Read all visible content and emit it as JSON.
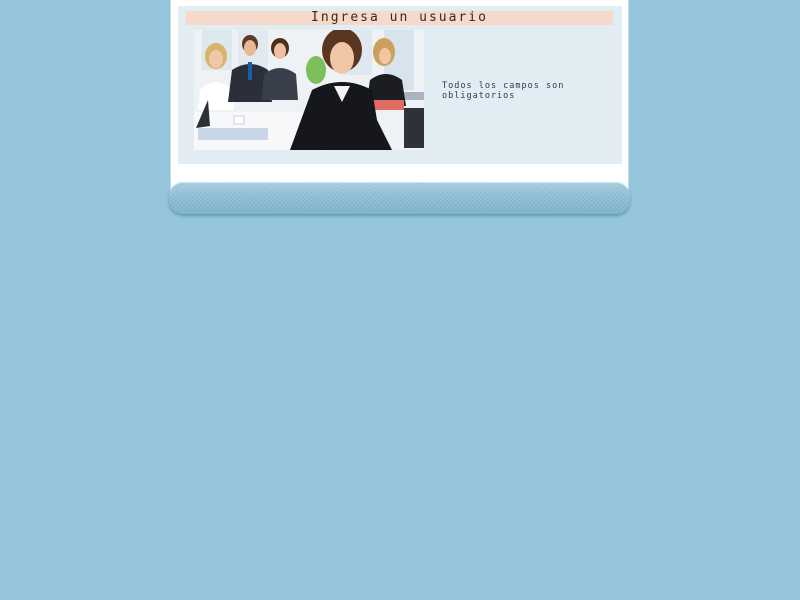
{
  "form": {
    "title": "Ingresa un usuario",
    "required_note": "Todos los campos son obligatorios",
    "photo_description_icon": "office-team-photo"
  },
  "colors": {
    "page_background": "#96c6dd",
    "form_background": "#e2ecf3",
    "title_bar": "#f6d9c9"
  }
}
